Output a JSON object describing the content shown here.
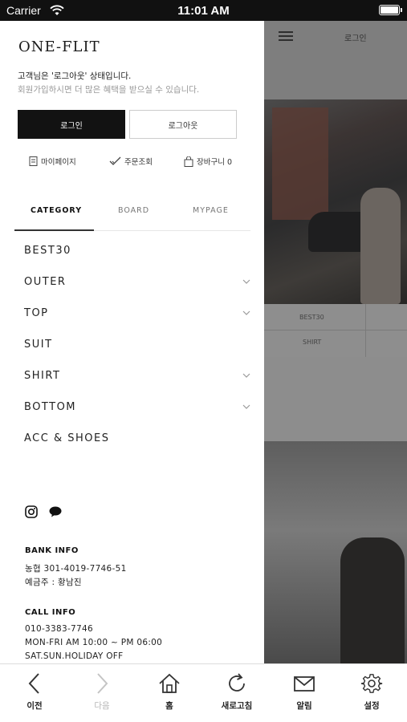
{
  "status_bar": {
    "carrier": "Carrier",
    "time": "11:01 AM"
  },
  "drawer": {
    "brand": "ONE-FLIT",
    "status_line1": "고객님은 '로그아웃' 상태입니다.",
    "status_line2": "회원가입하시면 더 많은 혜택을 받으실 수 있습니다.",
    "login_label": "로그인",
    "logout_label": "로그아웃",
    "quick_links": {
      "mypage": "마이페이지",
      "order": "주문조회",
      "cart": "장바구니 0"
    },
    "tabs": [
      "CATEGORY",
      "BOARD",
      "MYPAGE"
    ],
    "active_tab": "CATEGORY",
    "categories": [
      {
        "label": "BEST30",
        "expandable": false
      },
      {
        "label": "OUTER",
        "expandable": true
      },
      {
        "label": "TOP",
        "expandable": true
      },
      {
        "label": "SUIT",
        "expandable": false
      },
      {
        "label": "SHIRT",
        "expandable": true
      },
      {
        "label": "BOTTOM",
        "expandable": true
      },
      {
        "label": "ACC & SHOES",
        "expandable": false
      }
    ],
    "social_icons": [
      "instagram-icon",
      "kakaotalk-icon"
    ],
    "bank_info": {
      "title": "BANK INFO",
      "account": "농협 301-4019-7746-51",
      "holder": "예금주 : 황남진"
    },
    "call_info": {
      "title": "CALL INFO",
      "phone": "010-3383-7746",
      "hours": "MON-FRI AM 10:00 ~ PM 06:00",
      "holiday": "SAT.SUN.HOLIDAY OFF"
    }
  },
  "background_page": {
    "login_label": "로그인",
    "grid": [
      "BEST30",
      "SHIRT"
    ]
  },
  "toolbar": {
    "items": [
      {
        "label": "이전",
        "icon": "chevron-left-icon",
        "enabled": true
      },
      {
        "label": "다음",
        "icon": "chevron-right-icon",
        "enabled": false
      },
      {
        "label": "홈",
        "icon": "home-icon",
        "enabled": true
      },
      {
        "label": "새로고침",
        "icon": "refresh-icon",
        "enabled": true
      },
      {
        "label": "알림",
        "icon": "mail-icon",
        "enabled": true
      },
      {
        "label": "설정",
        "icon": "gear-icon",
        "enabled": true
      }
    ]
  }
}
